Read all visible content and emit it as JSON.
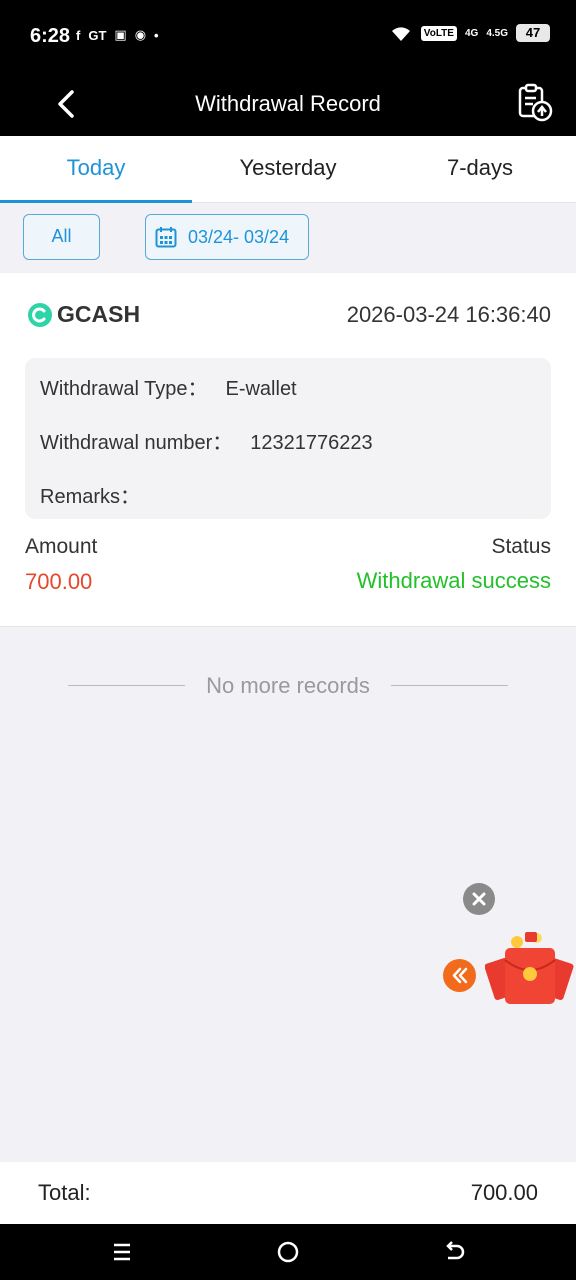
{
  "status_bar": {
    "time": "6:28",
    "app_icons": [
      "f",
      "GT",
      "▣",
      "◉",
      "•"
    ],
    "volte": "VoLTE",
    "net1": "4G",
    "net2": "4.5G",
    "battery": "47"
  },
  "header": {
    "title": "Withdrawal Record"
  },
  "tabs": [
    {
      "label": "Today"
    },
    {
      "label": "Yesterday"
    },
    {
      "label": "7-days"
    }
  ],
  "filters": {
    "all_label": "All",
    "date_range": "03/24- 03/24"
  },
  "record": {
    "brand": "GCASH",
    "datetime": "2026-03-24 16:36:40",
    "type_label": "Withdrawal Type：",
    "type_value": "E-wallet",
    "number_label": "Withdrawal number：",
    "number_value": "12321776223",
    "remarks_label": "Remarks：",
    "remarks_value": "",
    "amount_label": "Amount",
    "amount_value": "700.00",
    "status_label": "Status",
    "status_value": "Withdrawal success"
  },
  "list_end": {
    "text": "No more records"
  },
  "total": {
    "label": "Total:",
    "value": "700.00"
  },
  "colors": {
    "accent": "#1f93d8",
    "amount": "#e5482c",
    "success": "#22c02b",
    "brand_icon": "#2dd4a8"
  },
  "icons": {
    "back": "back-arrow-icon",
    "clipboard": "clipboard-upload-icon",
    "calendar": "calendar-icon",
    "brand": "gcash-logo-icon",
    "close": "close-icon",
    "expand": "double-chevron-left-icon",
    "promo": "red-envelope-icon",
    "nav_menu": "menu-icon",
    "nav_home": "home-circle-icon",
    "nav_back": "back-icon"
  }
}
